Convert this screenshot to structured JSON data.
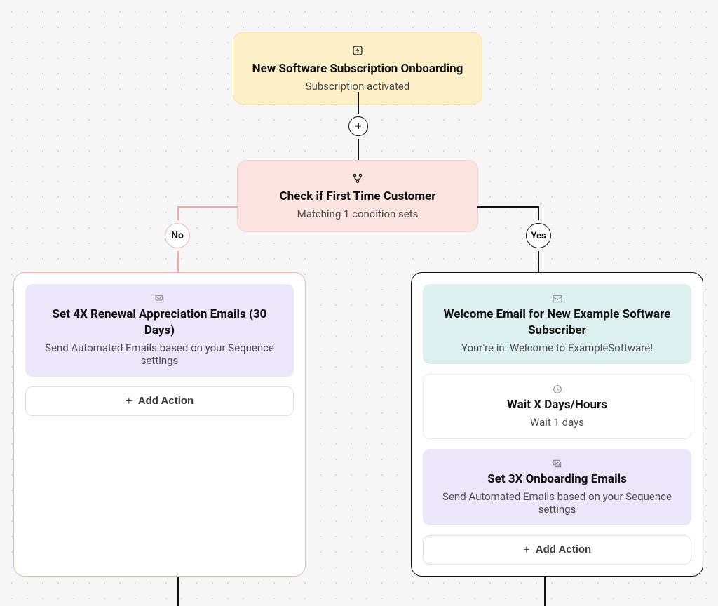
{
  "trigger": {
    "title": "New Software Subscription Onboarding",
    "subtitle": "Subscription activated"
  },
  "condition": {
    "title": "Check if First Time Customer",
    "subtitle": "Matching 1 condition sets",
    "no_label": "No",
    "yes_label": "Yes"
  },
  "no_branch": {
    "cards": [
      {
        "title": "Set 4X Renewal Appreciation Emails (30 Days)",
        "subtitle": "Send Automated Emails based on your Sequence settings"
      }
    ],
    "add_action_label": "Add Action"
  },
  "yes_branch": {
    "cards": [
      {
        "title": "Welcome Email for New Example Software Subscriber",
        "subtitle": "Your're in: Welcome to ExampleSoftware!"
      },
      {
        "title": "Wait X Days/Hours",
        "subtitle": "Wait 1 days"
      },
      {
        "title": "Set 3X Onboarding Emails",
        "subtitle": "Send Automated Emails based on your Sequence settings"
      }
    ],
    "add_action_label": "Add Action"
  }
}
